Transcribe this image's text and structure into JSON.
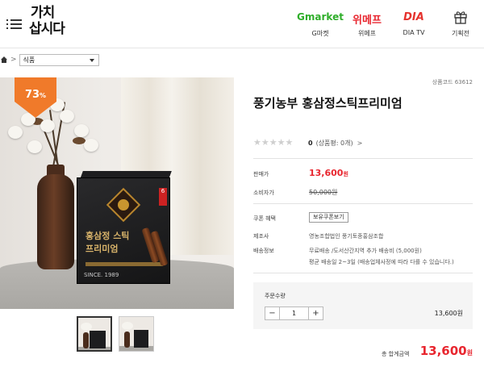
{
  "header": {
    "logo": "가치 삽시다",
    "partners": [
      {
        "mark": "Gmarket",
        "label": "G마켓"
      },
      {
        "mark": "위메프",
        "label": "위메프"
      },
      {
        "mark": "DIA",
        "label": "DIA TV"
      },
      {
        "mark": "gift",
        "label": "기획전"
      }
    ]
  },
  "breadcrumb": {
    "separator": ">",
    "category": "식품"
  },
  "product": {
    "discount_badge": "73",
    "discount_unit": "%",
    "box_title_line1": "홍삼정 스틱",
    "box_title_line2": "프리미엄",
    "box_since": "SINCE. 1989",
    "box_tag": "6",
    "code": "상품코드 63612",
    "title": "풍기농부 홍삼정스틱프리미엄",
    "review_count": "0",
    "review_text": "(상품평: 0개)",
    "review_chevron": ">",
    "labels": {
      "sale_price": "판매가",
      "consumer_price": "소비자가",
      "coupon": "쿠폰 혜택",
      "maker": "제조사",
      "shipping": "배송정보"
    },
    "sale_price": "13,600",
    "sale_price_unit": "원",
    "consumer_price": "50,000원",
    "coupon_button": "보유쿠폰보기",
    "maker": "영농조합법인 풍기토종홍삼조합",
    "shipping_line1": "무료배송 /도서산간지역 추가 배송비 (5,000원)",
    "shipping_line2": "평균 배송일 2~3일 (배송업체사정에 따라 다를 수 있습니다.)"
  },
  "order": {
    "label": "주문수량",
    "minus": "−",
    "plus": "+",
    "quantity": "1",
    "line_price": "13,600원",
    "total_label": "총 합계금액",
    "total_price": "13,600",
    "total_unit": "원"
  },
  "colors": {
    "accent": "#e8262f",
    "badge": "#f07a2a",
    "gmarket": "#2fae2a"
  }
}
